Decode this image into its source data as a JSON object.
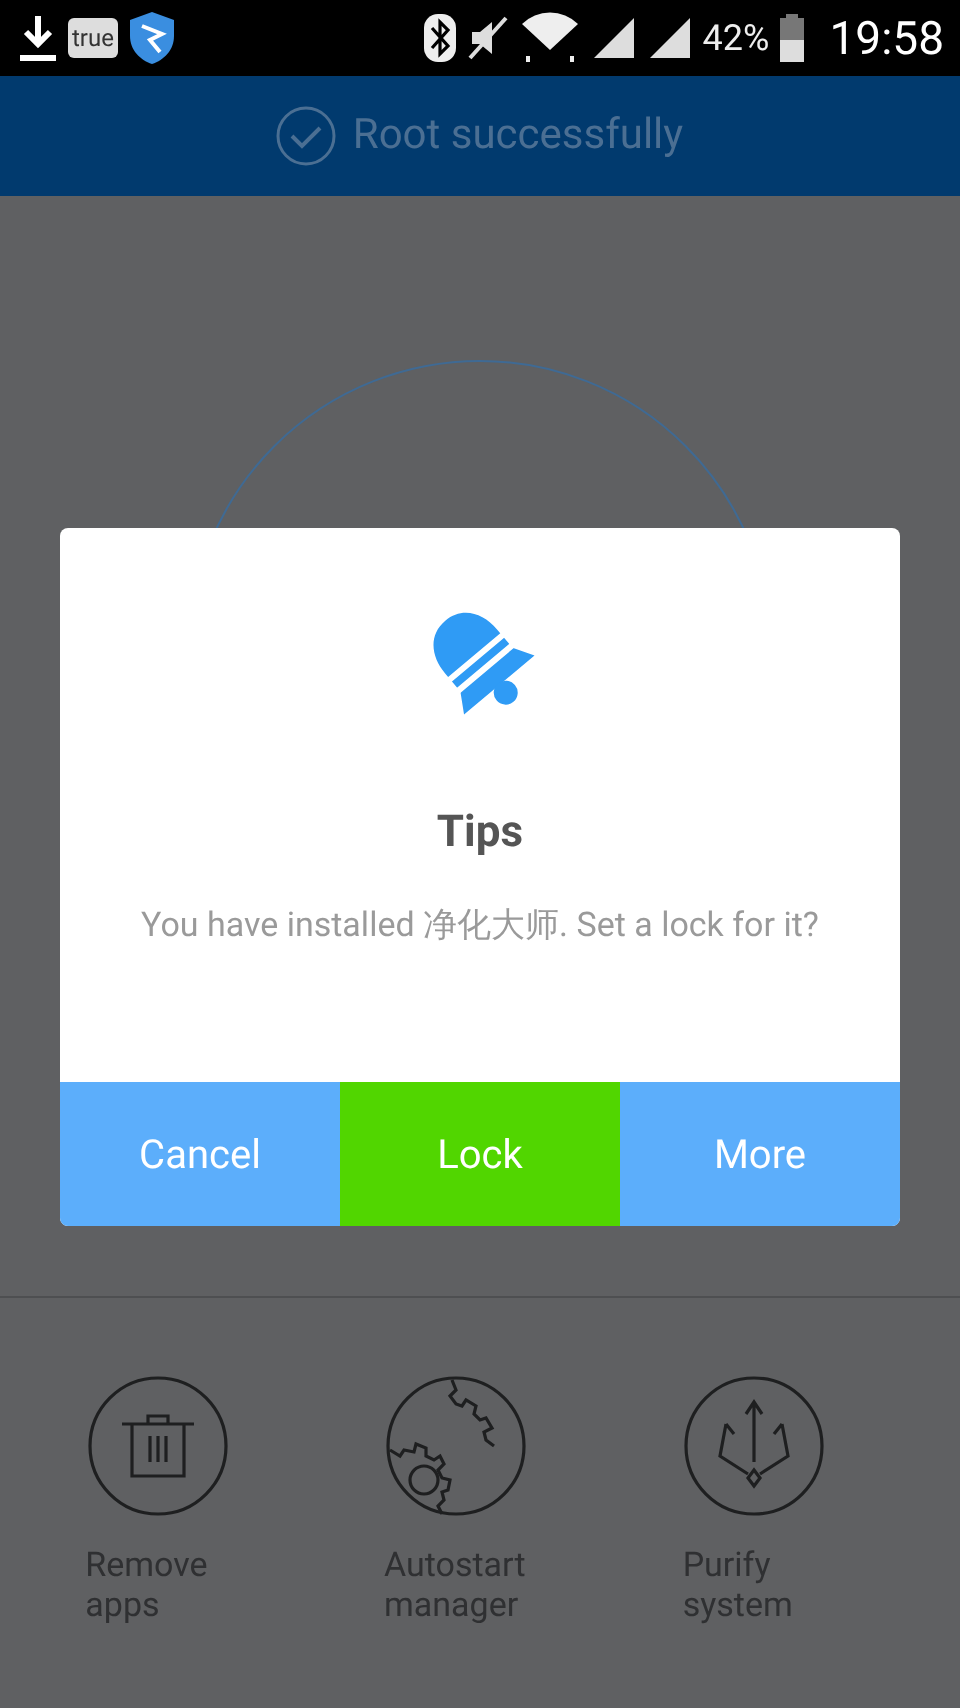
{
  "status_bar": {
    "notification_badge": "true",
    "battery": "42%",
    "time": "19:58"
  },
  "header": {
    "title": "Root successfully"
  },
  "tools": [
    {
      "label": "Remove apps",
      "kind": "trash"
    },
    {
      "label": "Autostart manager",
      "kind": "gears"
    },
    {
      "label": "Purify system",
      "kind": "trident"
    }
  ],
  "dialog": {
    "title": "Tips",
    "message": "You have installed 净化大师. Set a lock for it?",
    "buttons": [
      {
        "label": "Cancel",
        "kind": "secondary"
      },
      {
        "label": "Lock",
        "kind": "primary"
      },
      {
        "label": "More",
        "kind": "secondary"
      }
    ]
  }
}
